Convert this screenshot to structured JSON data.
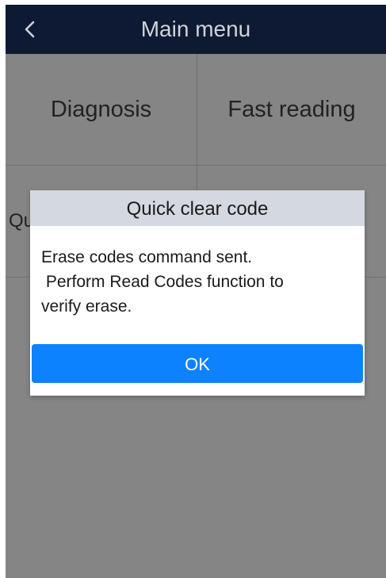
{
  "titlebar": {
    "title": "Main menu",
    "back_icon": "chevron-left-icon"
  },
  "menu": {
    "tiles": [
      {
        "label": "Diagnosis"
      },
      {
        "label": "Fast reading"
      },
      {
        "label": "Qu"
      },
      {
        "label": ""
      }
    ]
  },
  "dialog": {
    "title": "Quick clear code",
    "message": "Erase codes command sent.\n Perform Read Codes function to\nverify erase.",
    "ok_label": "OK"
  },
  "colors": {
    "titlebar_bg": "#0e1a33",
    "overlay_bg": "#858585",
    "dialog_header_bg": "#d4d8e0",
    "ok_button_bg": "#0d82ff"
  }
}
